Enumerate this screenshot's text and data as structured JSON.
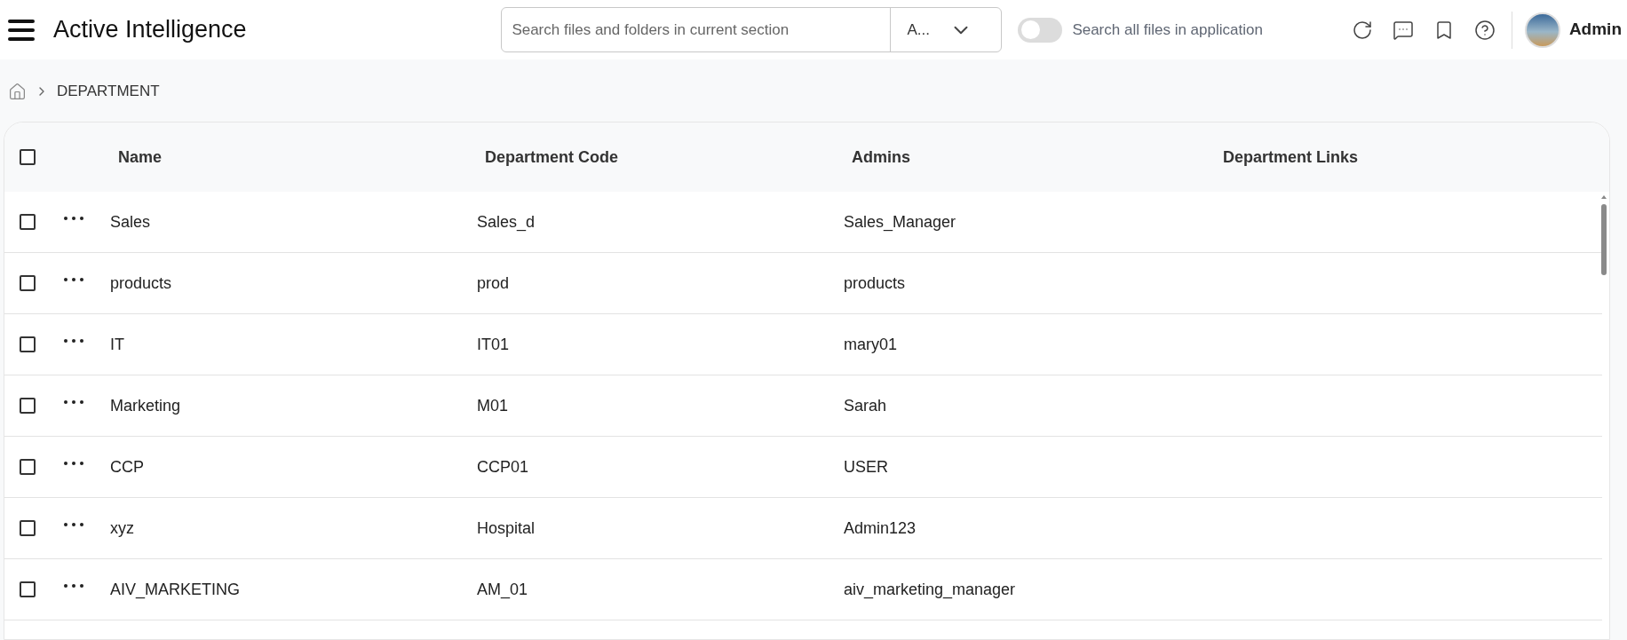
{
  "header": {
    "title": "Active Intelligence",
    "search": {
      "placeholder": "Search files and folders in current section"
    },
    "scope_dropdown": {
      "value": "A..."
    },
    "search_all_toggle": {
      "label": "Search all files in application",
      "on": false
    },
    "user": {
      "name": "Admin"
    }
  },
  "breadcrumb": [
    "DEPARTMENT"
  ],
  "table": {
    "select_all": {
      "checked": false
    },
    "columns": [
      "Name",
      "Department Code",
      "Admins",
      "Department Links"
    ],
    "rows": [
      {
        "checked": false,
        "name": "Sales",
        "code": "Sales_d",
        "admins": "Sales_Manager"
      },
      {
        "checked": false,
        "name": "products",
        "code": "prod",
        "admins": "products"
      },
      {
        "checked": false,
        "name": "IT",
        "code": "IT01",
        "admins": "mary01"
      },
      {
        "checked": false,
        "name": "Marketing",
        "code": "M01",
        "admins": "Sarah"
      },
      {
        "checked": false,
        "name": "CCP",
        "code": "CCP01",
        "admins": "USER"
      },
      {
        "checked": false,
        "name": "xyz",
        "code": "Hospital",
        "admins": "Admin123"
      },
      {
        "checked": false,
        "name": "AIV_MARKETING",
        "code": "AM_01",
        "admins": "aiv_marketing_manager"
      }
    ]
  }
}
